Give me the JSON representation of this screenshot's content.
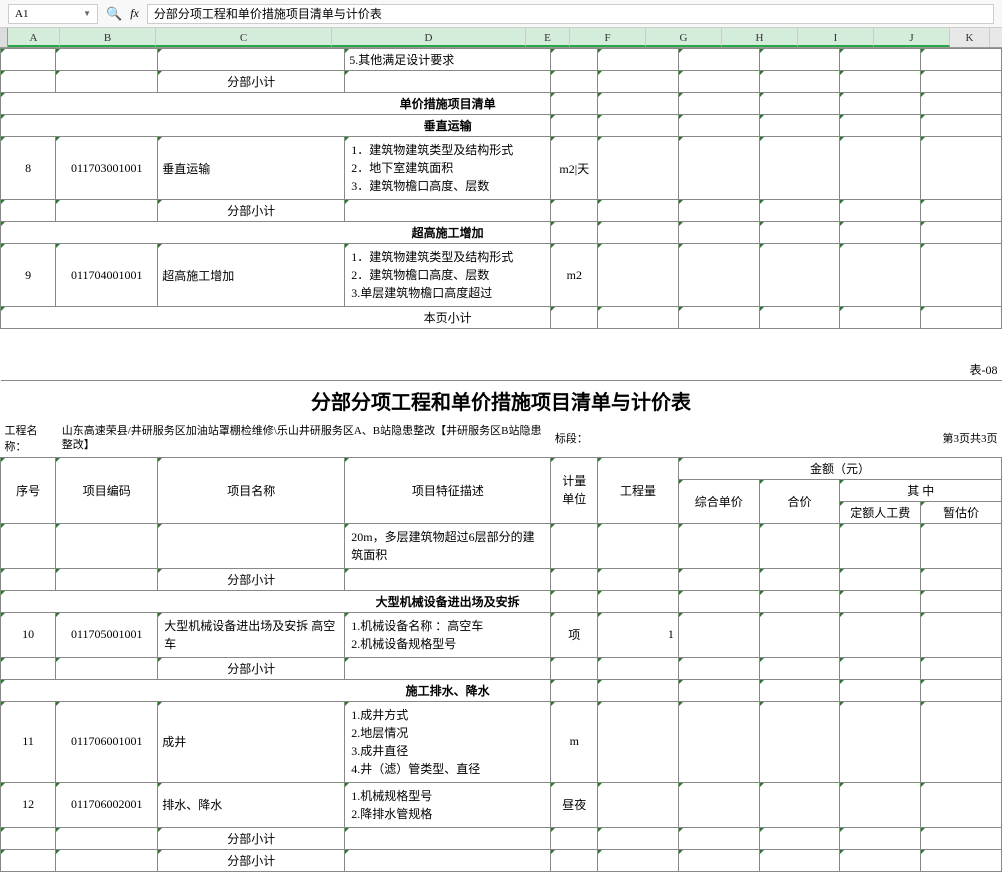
{
  "toolbar": {
    "cell_ref": "A1",
    "fx": "fx",
    "formula": "分部分项工程和单价措施项目清单与计价表"
  },
  "columns": [
    "A",
    "B",
    "C",
    "D",
    "E",
    "F",
    "G",
    "H",
    "I",
    "J",
    "K"
  ],
  "labels": {
    "subtotal": "分部小计",
    "page_subtotal": "本页小计",
    "section_unit_price": "单价措施项目清单",
    "vertical_transport": "垂直运输",
    "ultra_high": "超高施工增加",
    "large_machinery": "大型机械设备进出场及安拆",
    "drainage": "施工排水、降水"
  },
  "table_number": "表-08",
  "title": "分部分项工程和单价措施项目清单与计价表",
  "project_label": "工程名称：",
  "project_name": "山东高速荣县/井研服务区加油站罩棚检维修\\乐山井研服务区A、B站隐患整改【井研服务区B站隐患整改】",
  "section_label": "标段：",
  "page_label": "第3页共3页",
  "headers": {
    "seq": "序号",
    "code": "项目编码",
    "name": "项目名称",
    "feature": "项目特征描述",
    "unit": "计量单位",
    "qty": "工程量",
    "amount": "金额（元）",
    "unit_price": "综合单价",
    "total": "合价",
    "of_which": "其    中",
    "labor": "定额人工费",
    "provisional": "暂估价"
  },
  "rows": {
    "r1_d": "5.其他满足设计要求",
    "r8": {
      "seq": "8",
      "code": "011703001001",
      "name": "垂直运输",
      "feature": "1．建筑物建筑类型及结构形式\n2．地下室建筑面积\n3．建筑物檐口高度、层数",
      "unit": "m2|天"
    },
    "r9": {
      "seq": "9",
      "code": "011704001001",
      "name": "超高施工增加",
      "feature": "1．建筑物建筑类型及结构形式\n2．建筑物檐口高度、层数\n3.单层建筑物檐口高度超过",
      "unit": "m2"
    },
    "r_cont": "20m，多层建筑物超过6层部分的建筑面积",
    "r10": {
      "seq": "10",
      "code": "011705001001",
      "name": "大型机械设备进出场及安拆 高空车",
      "feature": "1.机械设备名称 ：高空车\n2.机械设备规格型号",
      "unit": "项",
      "qty": "1"
    },
    "r11": {
      "seq": "11",
      "code": "011706001001",
      "name": "成井",
      "feature": "1.成井方式\n2.地层情况\n3.成井直径\n4.井（滤）管类型、直径",
      "unit": "m"
    },
    "r12": {
      "seq": "12",
      "code": "011706002001",
      "name": "排水、降水",
      "feature": "1.机械规格型号\n2.降排水管规格",
      "unit": "昼夜"
    }
  }
}
